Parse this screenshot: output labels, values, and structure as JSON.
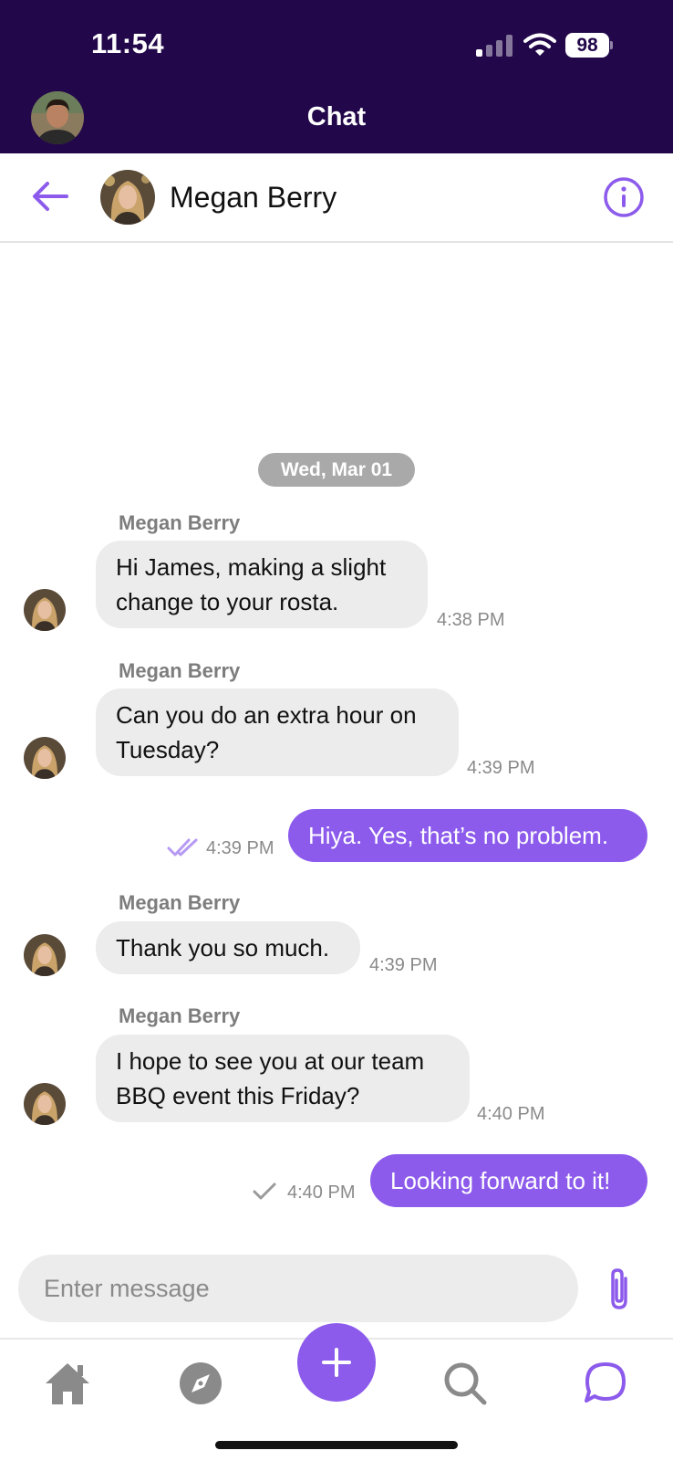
{
  "status_bar": {
    "time": "11:54",
    "battery": "98"
  },
  "app_bar": {
    "title": "Chat"
  },
  "chat_header": {
    "contact_name": "Megan Berry"
  },
  "messages": {
    "date_separator": "Wed, Mar 01",
    "items": [
      {
        "direction": "incoming",
        "sender": "Megan Berry",
        "text_lines": [
          "Hi James, making a slight",
          "change to your rosta."
        ],
        "time": "4:38 PM"
      },
      {
        "direction": "incoming",
        "sender": "Megan Berry",
        "text_lines": [
          "Can you do an extra hour on",
          "Tuesday?"
        ],
        "time": "4:39 PM"
      },
      {
        "direction": "outgoing",
        "text": "Hiya. Yes, that’s no problem.",
        "time": "4:39 PM",
        "status": "read"
      },
      {
        "direction": "incoming",
        "sender": "Megan Berry",
        "text": "Thank you so much.",
        "time": "4:39 PM"
      },
      {
        "direction": "incoming",
        "sender": "Megan Berry",
        "text_lines": [
          "I hope to see you at our team",
          "BBQ event this Friday?"
        ],
        "time": "4:40 PM"
      },
      {
        "direction": "outgoing",
        "text": "Looking forward to it!",
        "time": "4:40 PM",
        "status": "sent"
      }
    ]
  },
  "composer": {
    "placeholder": "Enter message"
  },
  "bottom_nav": {
    "items": [
      {
        "icon": "home-icon"
      },
      {
        "icon": "compass-icon"
      },
      {
        "icon": "plus-icon"
      },
      {
        "icon": "search-icon"
      },
      {
        "icon": "chat-bubble-icon",
        "active": true
      }
    ]
  },
  "colors": {
    "app_bar": "#22084a",
    "accent": "#8c5bec",
    "incoming_bubble": "#ececec",
    "inactive_icon": "#8a8a8a"
  }
}
